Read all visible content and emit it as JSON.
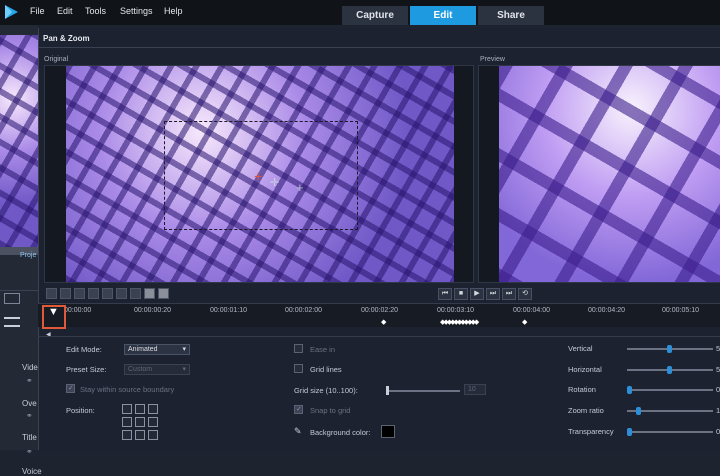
{
  "menu": [
    "File",
    "Edit",
    "Tools",
    "Settings",
    "Help"
  ],
  "tabs": [
    "Capture",
    "Edit",
    "Share"
  ],
  "active_tab": "Edit",
  "dialog": {
    "title": "Pan & Zoom",
    "original_label": "Original",
    "preview_label": "Preview"
  },
  "left": {
    "project": "Proje",
    "items": [
      "Vide",
      "Ove",
      "Title",
      "Voice"
    ]
  },
  "timeline": {
    "ticks": [
      "00:00:00",
      "00:00:00:20",
      "00:00:01:10",
      "00:00:02:00",
      "00:00:02:20",
      "00:00:03:10",
      "00:00:04:00",
      "00:00:04:20",
      "00:00:05:10"
    ],
    "keyframes": [
      "◆",
      "◆◆◆◆◆◆◆◆◆◆◆",
      "◆"
    ]
  },
  "settings": {
    "edit_mode_label": "Edit Mode:",
    "edit_mode_value": "Animated",
    "preset_size_label": "Preset Size:",
    "preset_size_value": "Custom",
    "stay_within": "Stay within source boundary",
    "position_label": "Position:",
    "ease_in": "Ease in",
    "grid_lines": "Grid lines",
    "grid_size_label": "Grid size (10..100):",
    "grid_size_value": "10",
    "snap_to_grid": "Snap to grid",
    "background_color": "Background color:",
    "background_hex": "#000000",
    "vertical": "Vertical",
    "horizontal": "Horizontal",
    "rotation": "Rotation",
    "zoom_ratio": "Zoom ratio",
    "transparency": "Transparency",
    "vertical_value": "5",
    "horizontal_value": "5",
    "rotation_value": "0",
    "zoom_ratio_value": "1",
    "transparency_value": "0"
  },
  "colors": {
    "accent": "#1e9be0",
    "selection": "#e05a3a"
  }
}
